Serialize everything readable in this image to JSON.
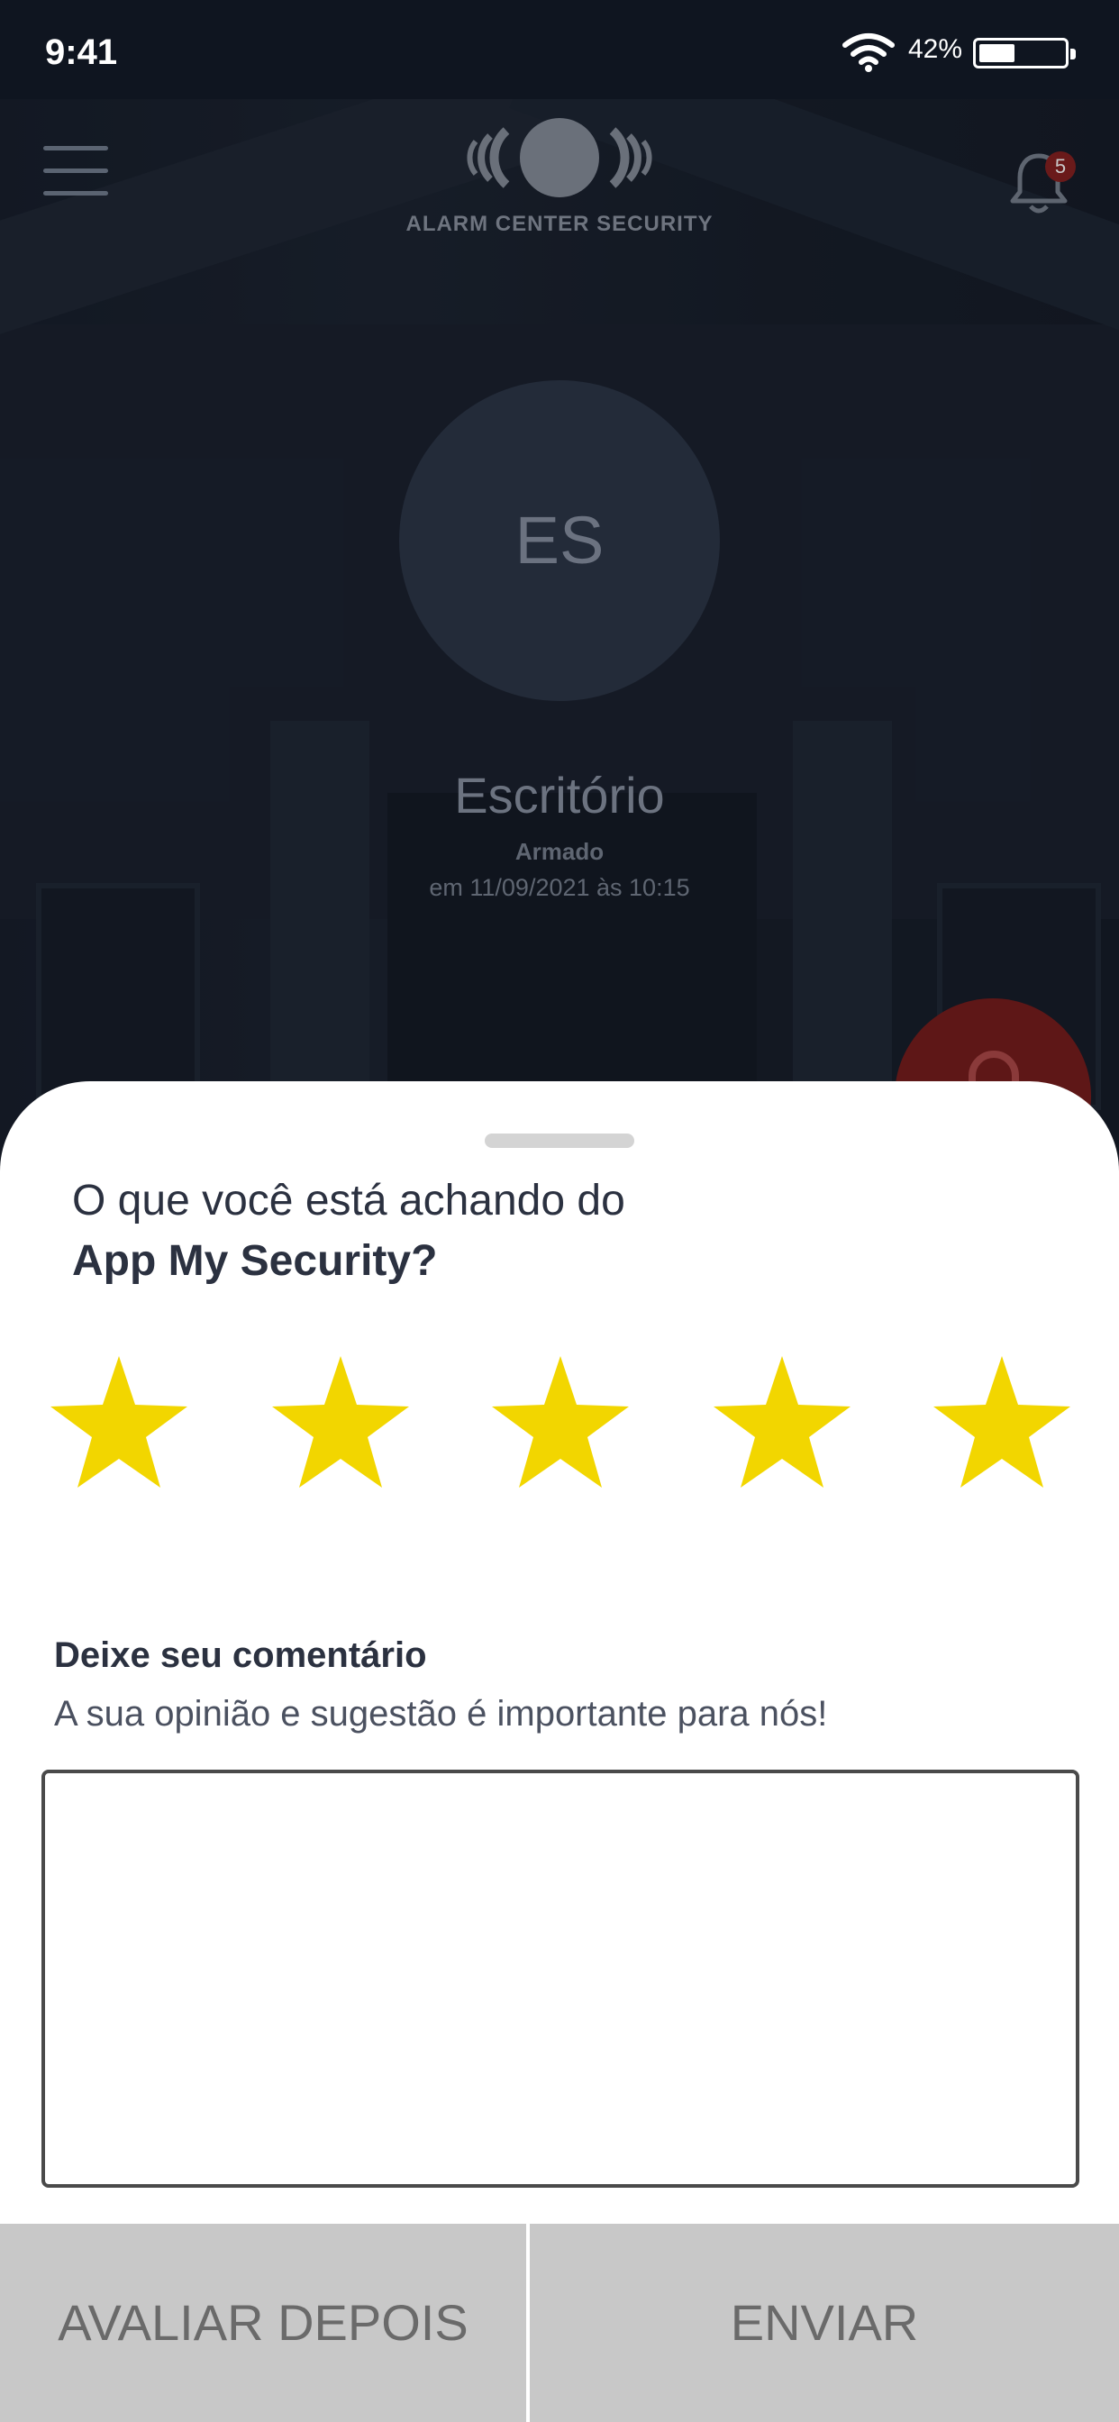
{
  "status_bar": {
    "time": "9:41",
    "battery_percent": "42%",
    "battery_level": 0.42
  },
  "header": {
    "logo_text": "ALARM CENTER SECURITY",
    "notification_count": "5"
  },
  "site": {
    "initials": "ES",
    "name": "Escritório",
    "state": "Armado",
    "date": "em 11/09/2021 às 10:15"
  },
  "rating_sheet": {
    "question_line1": "O que você está achando do",
    "question_line2": "App My Security?",
    "rating": 5,
    "max_rating": 5,
    "star_color": "#F2D600",
    "comment_title": "Deixe seu comentário",
    "comment_subtitle": "A sua opinião e sugestão é importante para nós!",
    "comment_value": "",
    "later_label": "AVALIAR DEPOIS",
    "send_label": "ENVIAR"
  },
  "icons": [
    "menu-icon",
    "bell-icon",
    "lock-icon",
    "star-icon",
    "wifi-icon",
    "battery-icon"
  ]
}
